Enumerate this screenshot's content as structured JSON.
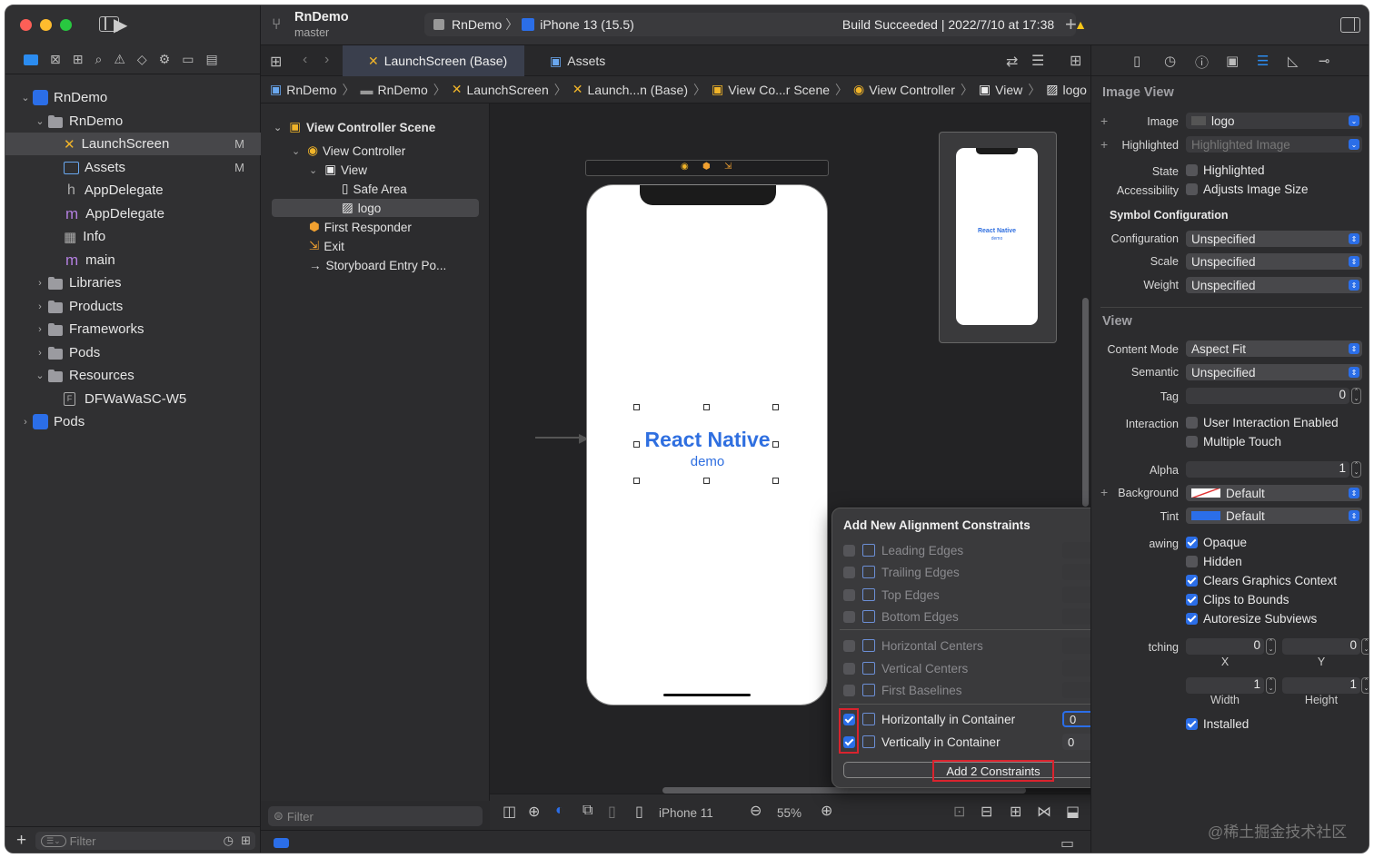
{
  "window": {
    "project": "RnDemo",
    "branch": "master",
    "scheme": "RnDemo",
    "device": "iPhone 13 (15.5)",
    "status": "Build Succeeded | 2022/7/10 at 17:38"
  },
  "navigator": {
    "items": [
      {
        "label": "RnDemo",
        "badge": ""
      },
      {
        "label": "RnDemo",
        "badge": ""
      },
      {
        "label": "LaunchScreen",
        "badge": "M"
      },
      {
        "label": "Assets",
        "badge": "M"
      },
      {
        "label": "AppDelegate",
        "badge": ""
      },
      {
        "label": "AppDelegate",
        "badge": ""
      },
      {
        "label": "Info",
        "badge": ""
      },
      {
        "label": "main",
        "badge": ""
      },
      {
        "label": "Libraries",
        "badge": ""
      },
      {
        "label": "Products",
        "badge": ""
      },
      {
        "label": "Frameworks",
        "badge": ""
      },
      {
        "label": "Pods",
        "badge": ""
      },
      {
        "label": "Resources",
        "badge": ""
      },
      {
        "label": "DFWaWaSC-W5",
        "badge": ""
      },
      {
        "label": "Pods",
        "badge": ""
      }
    ],
    "filter_placeholder": "Filter"
  },
  "tabs": {
    "active": "LaunchScreen (Base)",
    "other": "Assets"
  },
  "breadcrumb": [
    "RnDemo",
    "RnDemo",
    "LaunchScreen",
    "Launch...n (Base)",
    "View Co...r Scene",
    "View Controller",
    "View",
    "logo"
  ],
  "outline": {
    "scene": "View Controller Scene",
    "items": [
      "View Controller",
      "View",
      "Safe Area",
      "logo",
      "First Responder",
      "Exit",
      "Storyboard Entry Po..."
    ],
    "filter_placeholder": "Filter"
  },
  "canvas": {
    "logo_title": "React Native",
    "logo_sub": "demo",
    "device_label": "iPhone 11",
    "zoom": "55%",
    "mini_title": "React Native",
    "mini_sub": "demo"
  },
  "popup": {
    "title": "Add New Alignment Constraints",
    "items": [
      {
        "label": "Leading Edges",
        "checked": false,
        "value": ""
      },
      {
        "label": "Trailing Edges",
        "checked": false,
        "value": ""
      },
      {
        "label": "Top Edges",
        "checked": false,
        "value": ""
      },
      {
        "label": "Bottom Edges",
        "checked": false,
        "value": ""
      },
      {
        "label": "Horizontal Centers",
        "checked": false,
        "value": ""
      },
      {
        "label": "Vertical Centers",
        "checked": false,
        "value": ""
      },
      {
        "label": "First Baselines",
        "checked": false,
        "value": ""
      },
      {
        "label": "Horizontally in Container",
        "checked": true,
        "value": "0"
      },
      {
        "label": "Vertically in Container",
        "checked": true,
        "value": "0"
      }
    ],
    "button": "Add 2 Constraints"
  },
  "inspector": {
    "image_view_header": "Image View",
    "image_label": "Image",
    "image_value": "logo",
    "highlighted_label": "Highlighted",
    "highlighted_placeholder": "Highlighted Image",
    "state_label": "State",
    "state_option": "Highlighted",
    "accessibility_label": "Accessibility",
    "accessibility_option": "Adjusts Image Size",
    "symbol_header": "Symbol Configuration",
    "configuration_label": "Configuration",
    "configuration_value": "Unspecified",
    "scale_label": "Scale",
    "scale_value": "Unspecified",
    "weight_label": "Weight",
    "weight_value": "Unspecified",
    "view_header": "View",
    "content_mode_label": "Content Mode",
    "content_mode_value": "Aspect Fit",
    "semantic_label": "Semantic",
    "semantic_value": "Unspecified",
    "tag_label": "Tag",
    "tag_value": "0",
    "interaction_label": "Interaction",
    "user_interaction": "User Interaction Enabled",
    "multiple_touch": "Multiple Touch",
    "alpha_label": "Alpha",
    "alpha_value": "1",
    "background_label": "Background",
    "background_value": "Default",
    "tint_label": "Tint",
    "tint_value": "Default",
    "drawing_label": "awing",
    "opaque": "Opaque",
    "hidden": "Hidden",
    "clears": "Clears Graphics Context",
    "clips": "Clips to Bounds",
    "autoresize": "Autoresize Subviews",
    "stretching_label": "tching",
    "x_value": "0",
    "y_value": "0",
    "x_label": "X",
    "y_label": "Y",
    "w_value": "1",
    "h_value": "1",
    "w_label": "Width",
    "h_label": "Height",
    "installed": "Installed"
  },
  "watermark": "@稀土掘金技术社区",
  "colors": {
    "accent": "#2b6ee8",
    "logo_blue": "#2f6fe0",
    "highlight_red": "#d9232e"
  }
}
